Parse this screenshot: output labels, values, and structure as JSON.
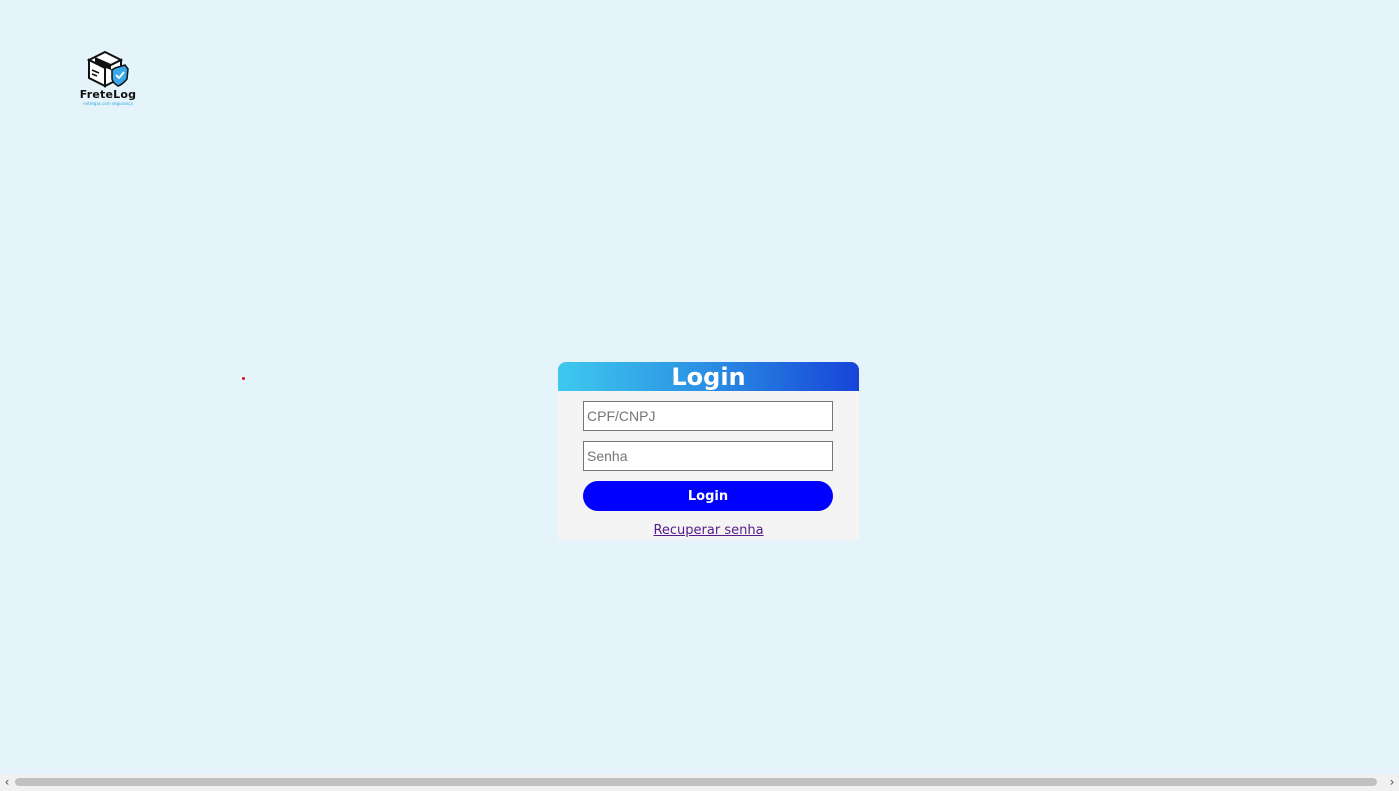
{
  "logo": {
    "name": "FreteLog",
    "tagline": "entregas com segurança",
    "icon": "box-shield-icon"
  },
  "login": {
    "title": "Login",
    "cpf_placeholder": "CPF/CNPJ",
    "senha_placeholder": "Senha",
    "button_label": "Login",
    "recover_label": "Recuperar senha"
  },
  "colors": {
    "background": "#e4f4fa",
    "header_gradient_start": "#3ec9ee",
    "header_gradient_end": "#1744d8",
    "button": "#0000ff",
    "link_visited": "#551a8b"
  },
  "scrollbar": {
    "left_arrow": "‹",
    "right_arrow": "›"
  }
}
